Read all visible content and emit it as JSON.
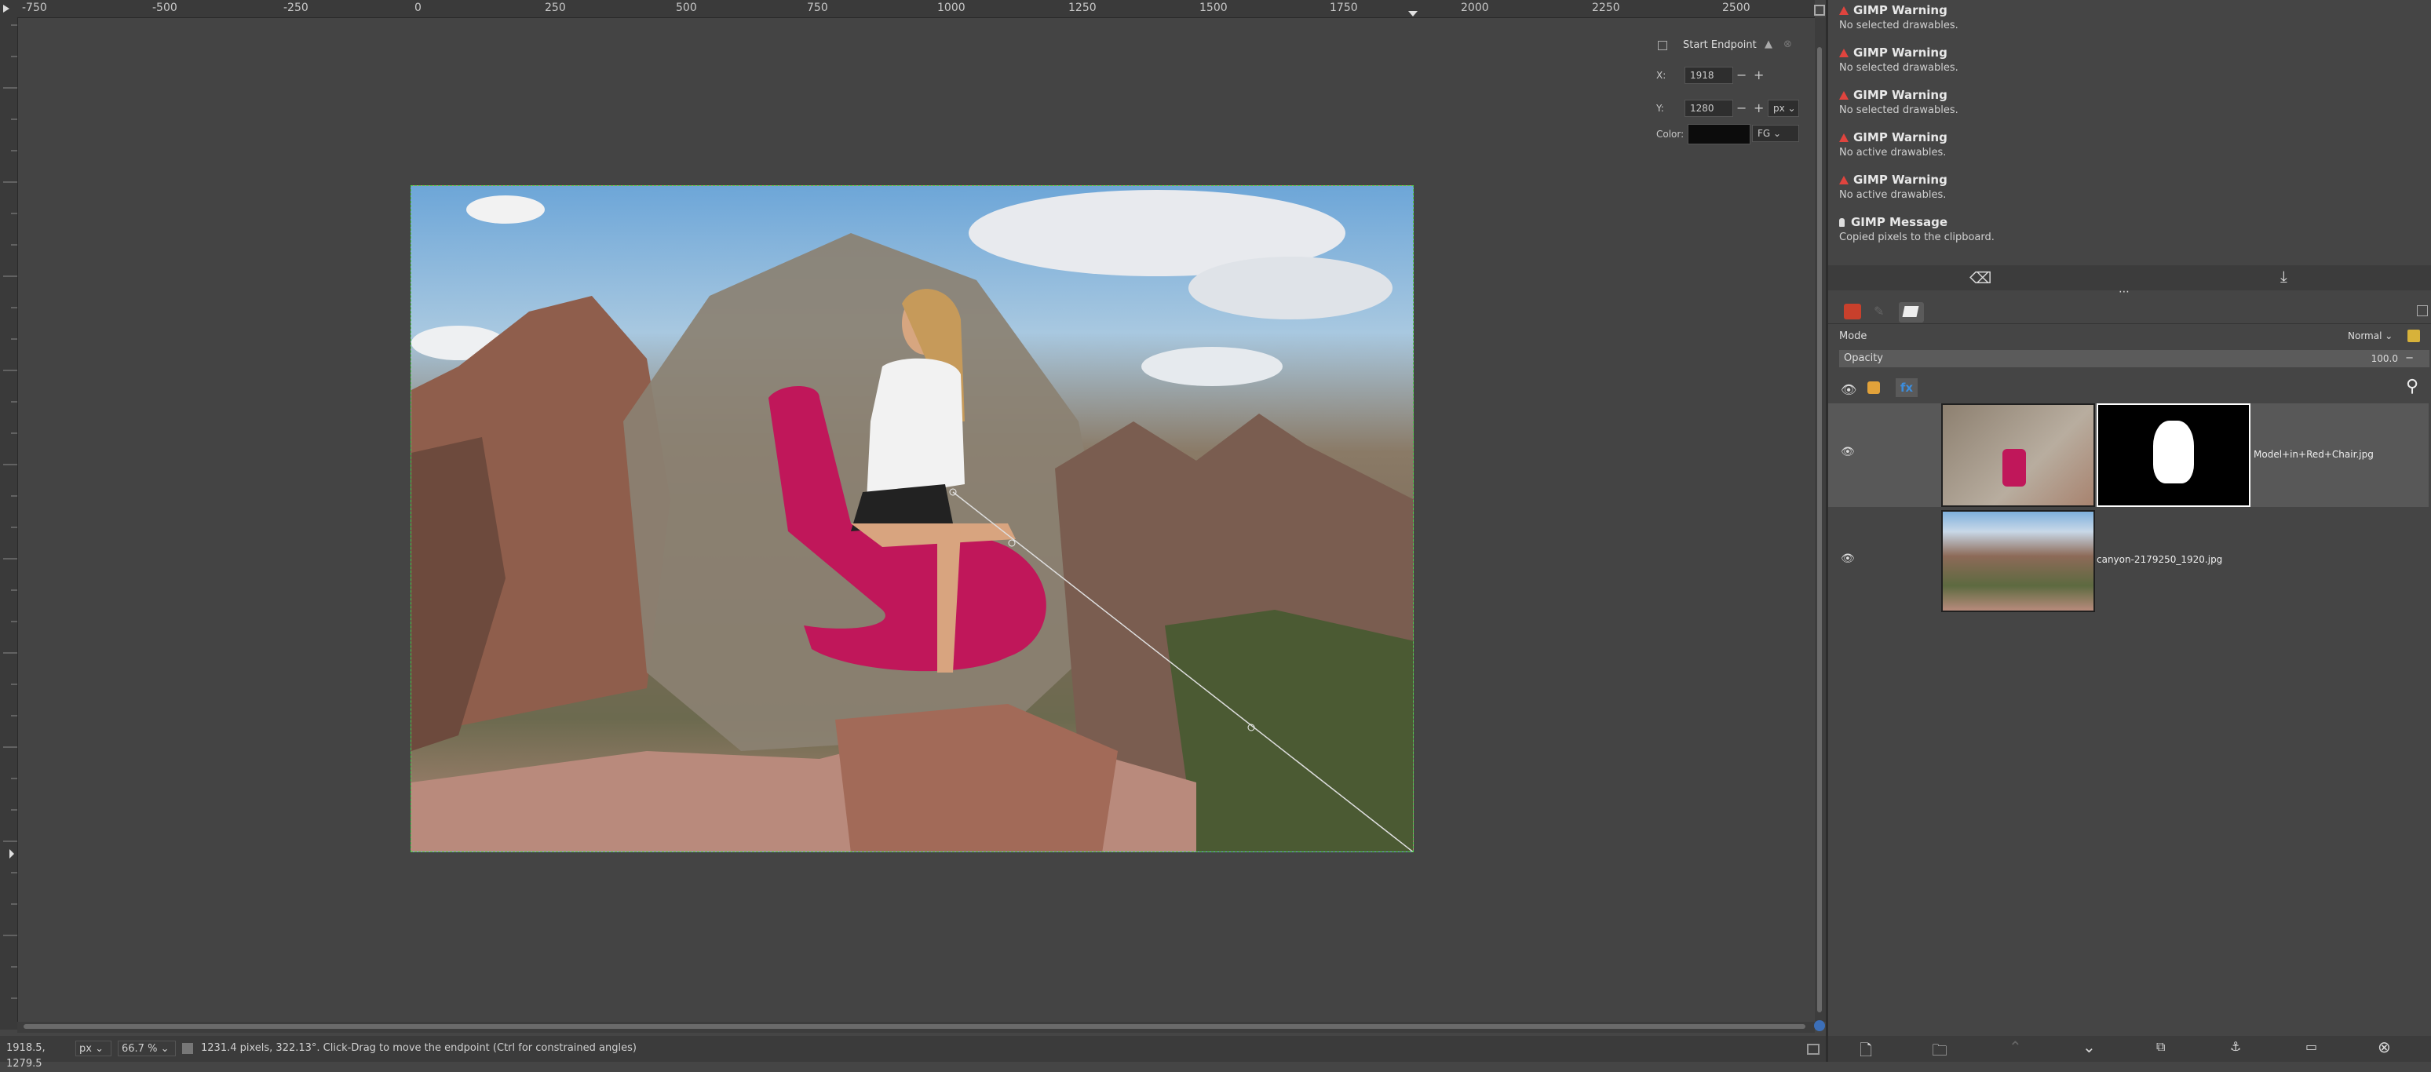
{
  "rulers": {
    "horizontal_labels": [
      "-750",
      "-500",
      "-250",
      "0",
      "250",
      "500",
      "750",
      "1000",
      "1250",
      "1500",
      "1750",
      "2000",
      "2250",
      "2500"
    ]
  },
  "tool_overlay": {
    "title": "Start Endpoint",
    "x_label": "X:",
    "x_value": "1918",
    "y_label": "Y:",
    "y_value": "1280",
    "unit": "px",
    "color_label": "Color:",
    "color_mode": "FG",
    "minus": "−",
    "plus": "+"
  },
  "statusbar": {
    "coords": "1918.5, 1279.5",
    "unit": "px",
    "zoom": "66.7 %",
    "message": "1231.4 pixels, 322.13°. Click-Drag to move the endpoint (Ctrl for constrained angles)"
  },
  "messages": [
    {
      "type": "warning",
      "title": "GIMP Warning",
      "body": "No selected drawables."
    },
    {
      "type": "warning",
      "title": "GIMP Warning",
      "body": "No selected drawables."
    },
    {
      "type": "warning",
      "title": "GIMP Warning",
      "body": "No selected drawables."
    },
    {
      "type": "warning",
      "title": "GIMP Warning",
      "body": "No active drawables."
    },
    {
      "type": "warning",
      "title": "GIMP Warning",
      "body": "No active drawables."
    },
    {
      "type": "info",
      "title": "GIMP Message",
      "body": "Copied pixels to the clipboard."
    }
  ],
  "layers_panel": {
    "mode_label": "Mode",
    "mode_value": "Normal",
    "opacity_label": "Opacity",
    "opacity_value": "100.0",
    "layers": [
      {
        "name": "Model+in+Red+Chair.jpg",
        "visible": true,
        "has_mask": true
      },
      {
        "name": "canyon-2179250_1920.jpg",
        "visible": true,
        "has_mask": false
      }
    ]
  },
  "colors": {
    "warning": "#e0443e",
    "selection_border": "#4fd04f",
    "chair": "#c0175a"
  }
}
